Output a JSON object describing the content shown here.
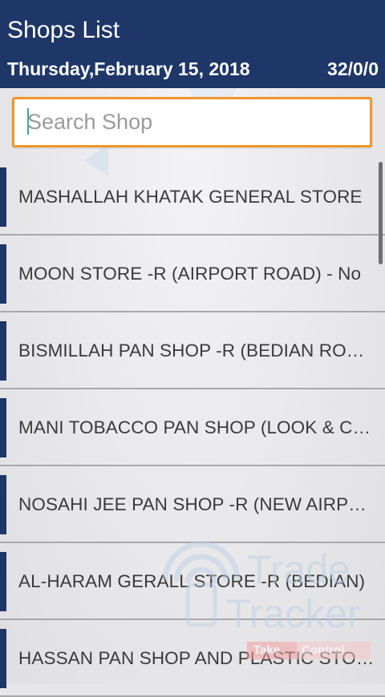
{
  "header": {
    "title": "Shops List",
    "date": "Thursday,February 15, 2018",
    "count": "32/0/0",
    "color": "#1e3668"
  },
  "search": {
    "placeholder": "Search Shop",
    "value": "",
    "border_color": "#f0962a"
  },
  "shops": [
    {
      "label": "MASHALLAH KHATAK GENERAL STORE"
    },
    {
      "label": "MOON STORE -R (AIRPORT ROAD) - No"
    },
    {
      "label": "BISMILLAH PAN SHOP -R (BEDIAN ROAD)"
    },
    {
      "label": "MANI TOBACCO PAN SHOP (LOOK & CHEW)"
    },
    {
      "label": "NOSAHI JEE PAN SHOP -R (NEW AIRPORT)"
    },
    {
      "label": "AL-HARAM GERALL STORE -R (BEDIAN)"
    },
    {
      "label": "HASSAN PAN SHOP AND PLASTIC STORE"
    }
  ],
  "watermark": {
    "line1": "Trade",
    "line2": "Tracker",
    "tag_a": "Take",
    "tag_b": "Control"
  }
}
